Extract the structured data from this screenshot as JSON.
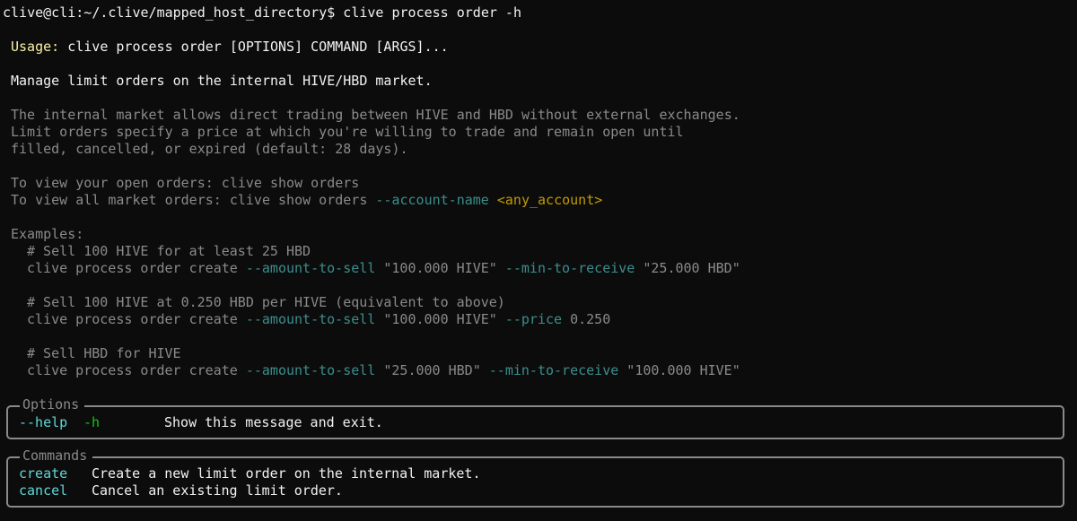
{
  "prompt": {
    "text": "clive@cli:~/.clive/mapped_host_directory$ clive process order -h"
  },
  "usage": {
    "label": "Usage:",
    "text": " clive process order [OPTIONS] COMMAND [ARGS]..."
  },
  "summary": "Manage limit orders on the internal HIVE/HBD market.",
  "description": [
    "The internal market allows direct trading between HIVE and HBD without external exchanges.",
    "Limit orders specify a price at which you're willing to trade and remain open until",
    "filled, cancelled, or expired (default: 28 days)."
  ],
  "view_open": "To view your open orders: clive show orders",
  "view_all": {
    "prefix": "To view all market orders: clive show orders ",
    "flag": "--account-name",
    "space": " ",
    "arg": "<any_account>"
  },
  "examples_label": "Examples:",
  "examples": {
    "ex1_comment": "# Sell 100 HIVE for at least 25 HBD",
    "ex1_cmd": "clive process order create ",
    "ex1_flag1": "--amount-to-sell",
    "ex1_val1": " \"100.000 HIVE\" ",
    "ex1_flag2": "--min-to-receive",
    "ex1_val2": " \"25.000 HBD\"",
    "ex2_comment": "# Sell 100 HIVE at 0.250 HBD per HIVE (equivalent to above)",
    "ex2_cmd": "clive process order create ",
    "ex2_flag1": "--amount-to-sell",
    "ex2_val1": " \"100.000 HIVE\" ",
    "ex2_flag2": "--price",
    "ex2_val2": " 0.250",
    "ex3_comment": "# Sell HBD for HIVE",
    "ex3_cmd": "clive process order create ",
    "ex3_flag1": "--amount-to-sell",
    "ex3_val1": " \"25.000 HBD\" ",
    "ex3_flag2": "--min-to-receive",
    "ex3_val2": " \"100.000 HIVE\""
  },
  "options_panel": {
    "title": "Options",
    "help_long": "--help",
    "help_short": "-h",
    "help_desc": "Show this message and exit."
  },
  "commands_panel": {
    "title": "Commands",
    "items": [
      {
        "name": "create",
        "desc": "Create a new limit order on the internal market."
      },
      {
        "name": "cancel",
        "desc": "Cancel an existing limit order."
      }
    ]
  }
}
